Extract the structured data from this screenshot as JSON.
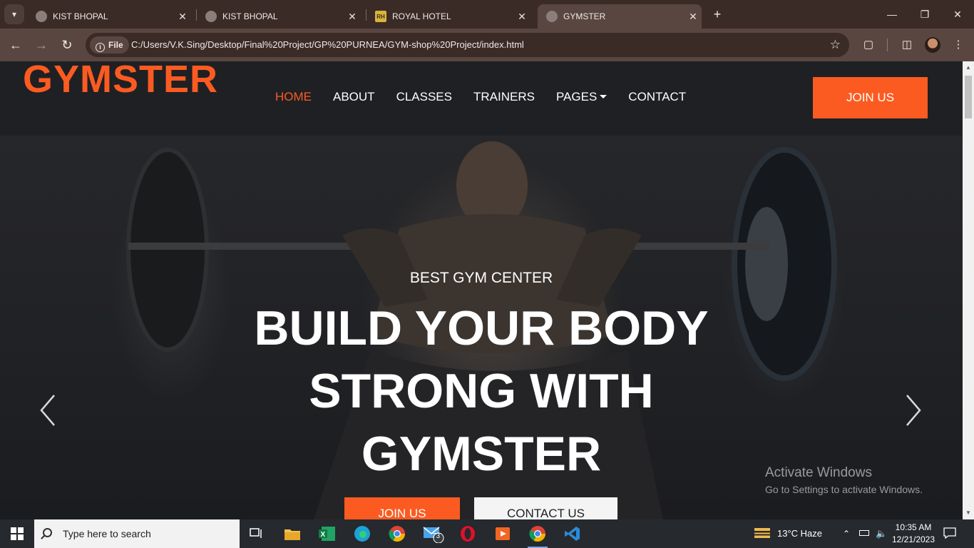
{
  "browser": {
    "tabs": [
      {
        "title": "KIST BHOPAL",
        "active": false
      },
      {
        "title": "KIST BHOPAL",
        "active": false
      },
      {
        "title": "ROYAL HOTEL",
        "active": false
      },
      {
        "title": "GYMSTER",
        "active": true
      }
    ],
    "file_chip": "File",
    "url": "C:/Users/V.K.Sing/Desktop/Final%20Project/GP%20PURNEA/GYM-shop%20Project/index.html"
  },
  "site": {
    "logo": "GYMSTER",
    "nav": [
      {
        "label": "HOME",
        "active": true
      },
      {
        "label": "ABOUT"
      },
      {
        "label": "CLASSES"
      },
      {
        "label": "TRAINERS"
      },
      {
        "label": "PAGES",
        "dropdown": true
      },
      {
        "label": "CONTACT"
      }
    ],
    "join_button": "JOIN US",
    "accent": "#fb5b21",
    "hero": {
      "subtitle": "BEST GYM CENTER",
      "title_lines": [
        "BUILD YOUR BODY",
        "STRONG WITH",
        "GYMSTER"
      ],
      "primary_button": "JOIN US",
      "secondary_button": "CONTACT US"
    }
  },
  "watermark": {
    "line1": "Activate Windows",
    "line2": "Go to Settings to activate Windows."
  },
  "taskbar": {
    "search_placeholder": "Type here to search",
    "mail_badge": "73",
    "weather": "13°C  Haze",
    "time": "10:35 AM",
    "date": "12/21/2023"
  }
}
